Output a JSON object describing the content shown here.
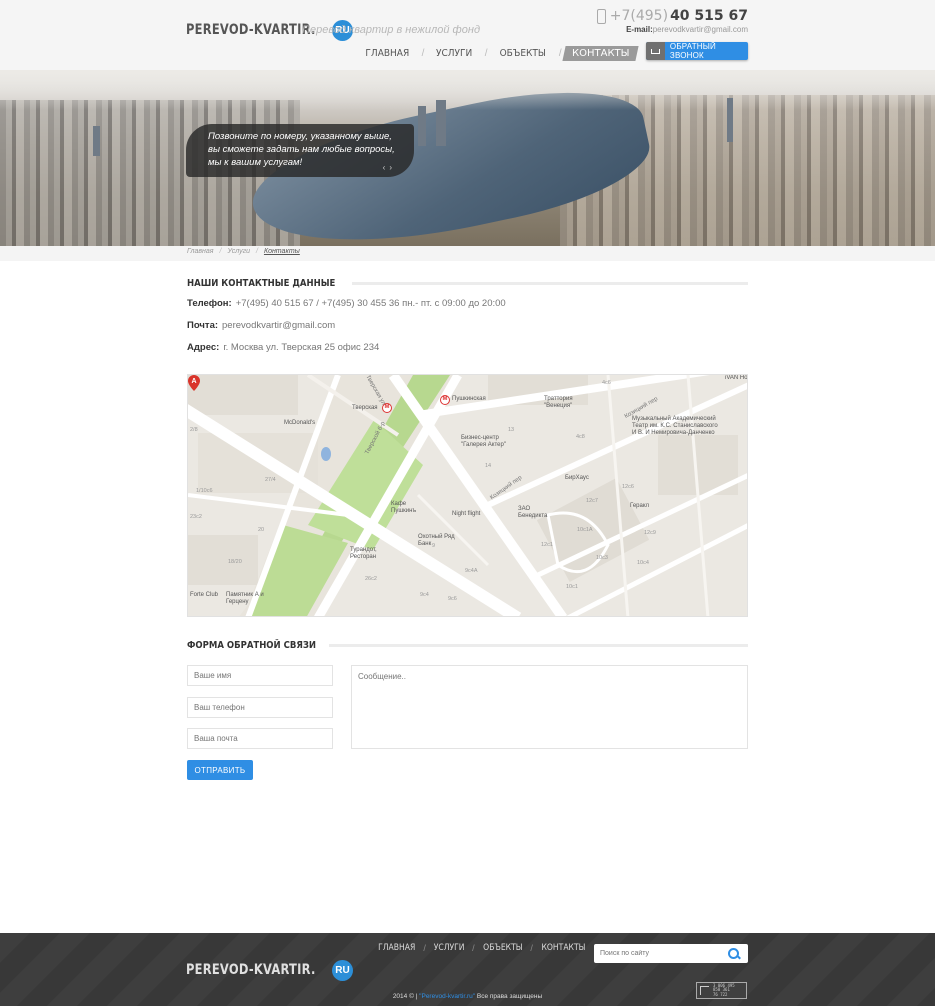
{
  "brand": {
    "logo": "PEREVOD-KVARTIR.",
    "logo_badge": "RU",
    "tagline": "Перевод квартир в нежилой фонд"
  },
  "contact": {
    "phone_prefix": "+7(495)",
    "phone_main": "40 515 67",
    "email_label": "E-mail:",
    "email": "perevodkvartir@gmail.com",
    "callback_label": "ОБРАТНЫЙ ЗВОНОК"
  },
  "nav": {
    "items": [
      "ГЛАВНАЯ",
      "УСЛУГИ",
      "ОБЪЕКТЫ",
      "КОНТАКТЫ"
    ],
    "separator": "/",
    "active": "КОНТАКТЫ"
  },
  "hero": {
    "caption": "Позвоните по номеру, указанному выше, вы сможете задать нам любые вопросы, мы к вашим услугам!",
    "prev": "‹",
    "next": "›"
  },
  "breadcrumb": [
    "Главная",
    "Услуги",
    "Контакты"
  ],
  "contacts_section": {
    "title": "НАШИ КОНТАКТНЫЕ ДАННЫЕ",
    "phone_label": "Телефон:",
    "phone_value": "+7(495) 40 515 67  /  +7(495) 30 455 36  пн.- пт. с 09:00 до 20:00",
    "mail_label": "Почта:",
    "mail_value": "perevodkvartir@gmail.com",
    "address_label": "Адрес:",
    "address_value": "г. Москва ул. Тверская 25 офис 234"
  },
  "map": {
    "marker": "A",
    "labels": {
      "tverskaya": "Тверская",
      "pushkinskaya": "Пушкинская",
      "mcdonalds": "McDonald's",
      "trattoria": "Траттория \"Венеция\"",
      "theatre": "Музыкальный Академический Театр им. К.С. Станиславского И В. И Немировича-Данченко",
      "actor": "Бизнес-центр \"Галерея Актер\"",
      "cafe_pushkin": "Кафе Пушкинъ",
      "night_flight": "Night flight",
      "venedikta": "ЗАО Бенедикта",
      "okhotny": "Охотный Ряд Банк",
      "turandot": "Турандот, Ресторан",
      "birhaus": "БирХаус",
      "gerakl": "Геракл",
      "forte": "Forte Club",
      "monument": "Памятник А и Герцену",
      "ivan": "iVAN Ho",
      "kozitsky1": "Козицкий пер",
      "kozitsky2": "Козицкий пер",
      "tverskaya_st": "Тверская ул",
      "tverskaya_b": "Тверской б-р"
    },
    "numbers": [
      "2/8",
      "1/10с6",
      "23с2",
      "18/20",
      "20",
      "27/4",
      "4с6",
      "13",
      "14",
      "12с7",
      "10с1А",
      "12с9",
      "10с3",
      "12с1",
      "10с4",
      "26с2",
      "9с4",
      "9с6",
      "9с4А",
      "10с1",
      "12с6",
      "4с8",
      "9"
    ]
  },
  "form_section": {
    "title": "ФОРМА ОБРАТНОЙ СВЯЗИ",
    "name_placeholder": "Ваше имя",
    "phone_placeholder": "Ваш телефон",
    "email_placeholder": "Ваша почта",
    "message_placeholder": "Сообщение..",
    "submit_label": "ОТПРАВИТЬ"
  },
  "footer": {
    "nav": [
      "ГЛАВНАЯ",
      "УСЛУГИ",
      "ОБЪЕКТЫ",
      "КОНТАКТЫ"
    ],
    "separator": "/",
    "search_placeholder": "Поиск по сайту",
    "copyright_prefix": "2014 © | ",
    "copyright_link": "\"Perevod-kvartir.ru\"",
    "copyright_suffix": " Все права защищены",
    "counter_line1": "3 006 495",
    "counter_line2": "858 361",
    "counter_line3": "76 722"
  },
  "colors": {
    "accent": "#2f8ee4",
    "footer_bg": "#383838",
    "header_bg": "#f5f5f5"
  },
  "icons": [
    "phone-icon",
    "download-icon",
    "search-icon",
    "metro-icon",
    "map-marker-icon",
    "counter-logo-icon"
  ]
}
